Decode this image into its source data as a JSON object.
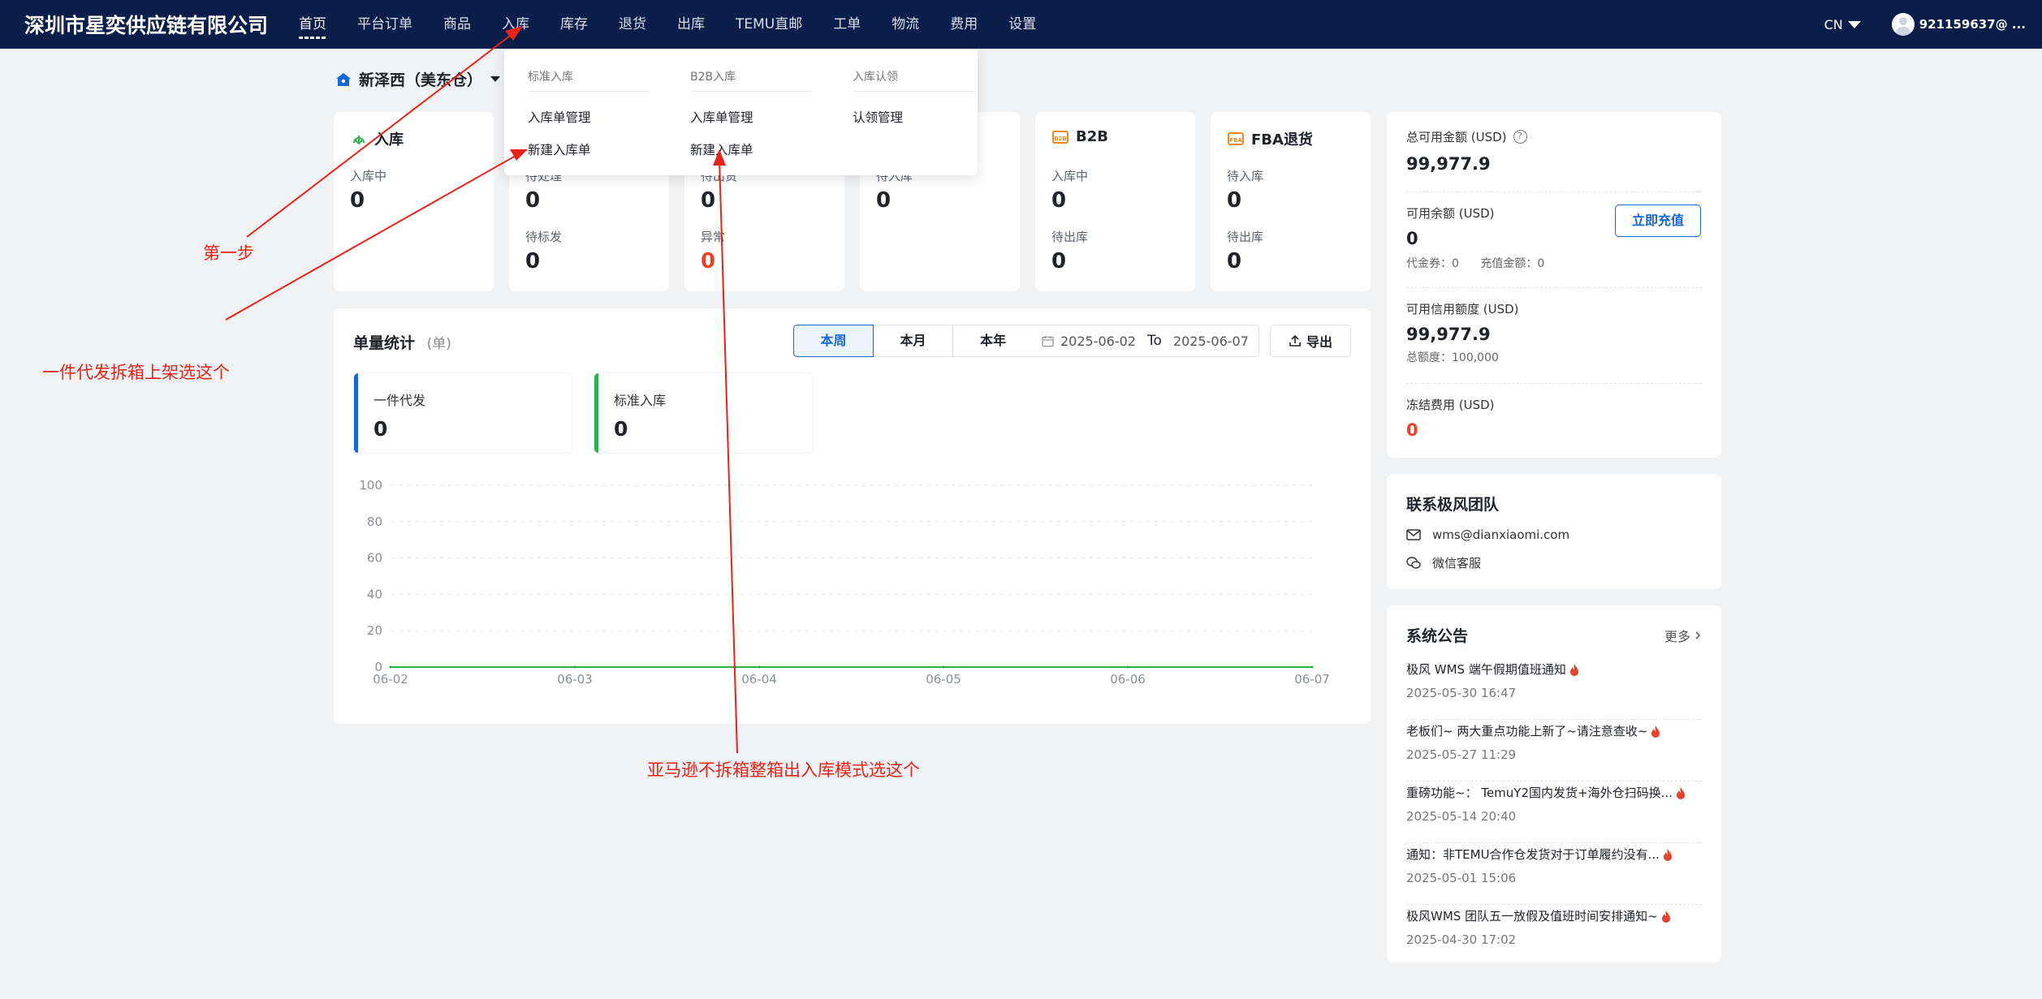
{
  "brand": "深圳市星奕供应链有限公司",
  "nav": {
    "items": [
      {
        "label": "首页",
        "active": true
      },
      {
        "label": "平台订单"
      },
      {
        "label": "商品"
      },
      {
        "label": "入库"
      },
      {
        "label": "库存"
      },
      {
        "label": "退货"
      },
      {
        "label": "出库"
      },
      {
        "label": "TEMU直邮"
      },
      {
        "label": "工单"
      },
      {
        "label": "物流"
      },
      {
        "label": "费用"
      },
      {
        "label": "设置"
      }
    ],
    "lang": "CN",
    "user": "921159637@ ..."
  },
  "warehouse": "新泽西（美东仓）",
  "dropdown": {
    "col1": {
      "header": "标准入库",
      "items": [
        "入库单管理",
        "新建入库单"
      ]
    },
    "col2": {
      "header": "B2B入库",
      "items": [
        "入库单管理",
        "新建入库单"
      ]
    },
    "col3": {
      "header": "入库认领",
      "items": [
        "认领管理"
      ]
    }
  },
  "stats": {
    "inbound": {
      "title": "入库",
      "r1_label": "入库中",
      "r1_value": "0"
    },
    "card2": {
      "r1_label": "待处理",
      "r1_value": "0",
      "r2_label": "待标发",
      "r2_value": "0"
    },
    "card3": {
      "r1_label": "待出货",
      "r1_value": "0",
      "r2_label": "异常",
      "r2_value": "0"
    },
    "card4": {
      "r1_label": "待入库",
      "r1_value": "0"
    },
    "b2b": {
      "title": "B2B",
      "r1_label": "入库中",
      "r1_value": "0",
      "r2_label": "待出库",
      "r2_value": "0"
    },
    "fba": {
      "title": "FBA退货",
      "r1_label": "待入库",
      "r1_value": "0",
      "r2_label": "待出库",
      "r2_value": "0"
    }
  },
  "balance": {
    "total_label": "总可用金额 (USD)",
    "total_value": "99,977.9",
    "avail_label": "可用余额 (USD)",
    "avail_value": "0",
    "coupon": "代金券：0",
    "recharge_amount": "充值金额：0",
    "recharge_btn": "立即充值",
    "credit_label": "可用信用额度 (USD)",
    "credit_value": "99,977.9",
    "credit_total": "总额度：100,000",
    "frozen_label": "冻结费用 (USD)",
    "frozen_value": "0"
  },
  "contact": {
    "title": "联系极风团队",
    "email": "wms@dianxiaomi.com",
    "wechat": "微信客服"
  },
  "notices": {
    "title": "系统公告",
    "more": "更多",
    "items": [
      {
        "title": "极风 WMS 端午假期值班通知",
        "date": "2025-05-30 16:47"
      },
      {
        "title": "老板们~ 两大重点功能上新了~请注意查收~",
        "date": "2025-05-27 11:29"
      },
      {
        "title": "重磅功能~： TemuY2国内发货+海外仓扫码换...",
        "date": "2025-05-14 20:40"
      },
      {
        "title": "通知：非TEMU合作仓发货对于订单履约没有...",
        "date": "2025-05-01 15:06"
      },
      {
        "title": "极风WMS 团队五一放假及值班时间安排通知~",
        "date": "2025-04-30 17:02"
      }
    ]
  },
  "volume": {
    "title": "单量统计",
    "unit": "(单)",
    "tabs": [
      "本周",
      "本月",
      "本年"
    ],
    "date_from": "2025-06-02",
    "date_to_label": "To",
    "date_to": "2025-06-07",
    "export": "导出",
    "mini1": {
      "label": "一件代发",
      "value": "0"
    },
    "mini2": {
      "label": "标准入库",
      "value": "0"
    }
  },
  "chart_data": {
    "type": "line",
    "categories": [
      "06-02",
      "06-03",
      "06-04",
      "06-05",
      "06-06",
      "06-07"
    ],
    "series": [
      {
        "values": [
          0,
          0,
          0,
          0,
          0,
          0
        ],
        "color": "#2bb24c"
      }
    ],
    "ylim": [
      0,
      100
    ],
    "yticks": [
      0,
      20,
      40,
      60,
      80,
      100
    ],
    "grid": true
  },
  "annotations": {
    "step1": "第一步",
    "dropship": "一件代发拆箱上架选这个",
    "amazon": "亚马逊不拆箱整箱出入库模式选这个"
  },
  "colors": {
    "nav_bg": "#0b1e4a",
    "accent": "#1766d6",
    "red": "#e8412c",
    "annotation": "#e8231a"
  }
}
